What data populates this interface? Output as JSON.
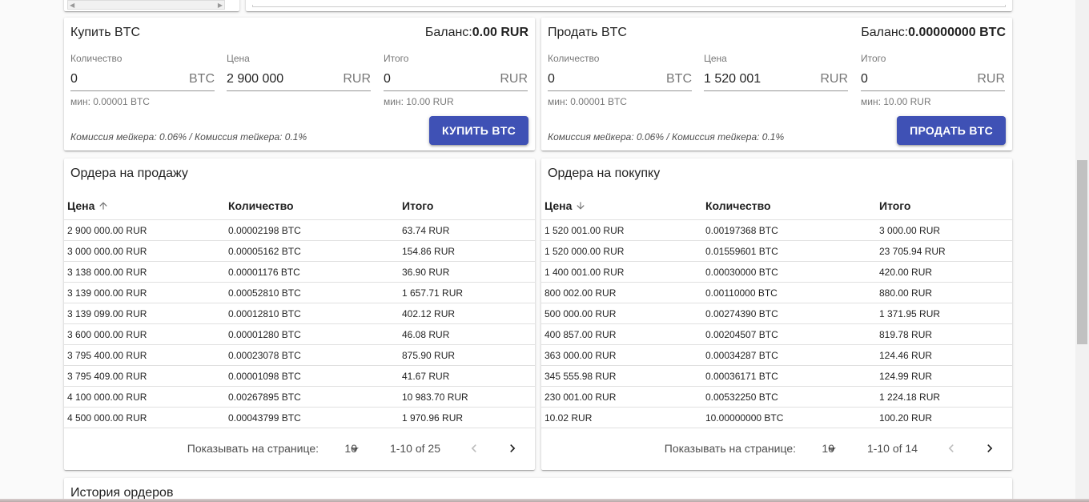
{
  "buy": {
    "title": "Купить BTC",
    "balance_label": "Баланс:",
    "balance_value": "0.00 RUR",
    "quantity": {
      "label": "Количество",
      "value": "0",
      "unit": "BTC",
      "hint": "мин: 0.00001 BTC"
    },
    "price": {
      "label": "Цена",
      "value": "2 900 000",
      "unit": "RUR"
    },
    "total": {
      "label": "Итого",
      "value": "0",
      "unit": "RUR",
      "hint": "мин: 10.00 RUR"
    },
    "commission": "Комиссия мейкера: 0.06% / Комиссия тейкера: 0.1%",
    "button": "КУПИТЬ BTC"
  },
  "sell": {
    "title": "Продать BTC",
    "balance_label": "Баланс:",
    "balance_value": "0.00000000 BTC",
    "quantity": {
      "label": "Количество",
      "value": "0",
      "unit": "BTC",
      "hint": "мин: 0.00001 BTC"
    },
    "price": {
      "label": "Цена",
      "value": "1 520 001",
      "unit": "RUR"
    },
    "total": {
      "label": "Итого",
      "value": "0",
      "unit": "RUR",
      "hint": "мин: 10.00 RUR"
    },
    "commission": "Комиссия мейкера: 0.06% / Комиссия тейкера: 0.1%",
    "button": "ПРОДАТЬ BTC"
  },
  "asks": {
    "title": "Ордера на продажу",
    "columns": [
      "Цена",
      "Количество",
      "Итого"
    ],
    "sort_icon": "arrow-up-icon",
    "rows": [
      [
        "2 900 000.00 RUR",
        "0.00002198 BTC",
        "63.74 RUR"
      ],
      [
        "3 000 000.00 RUR",
        "0.00005162 BTC",
        "154.86 RUR"
      ],
      [
        "3 138 000.00 RUR",
        "0.00001176 BTC",
        "36.90 RUR"
      ],
      [
        "3 139 000.00 RUR",
        "0.00052810 BTC",
        "1 657.71 RUR"
      ],
      [
        "3 139 099.00 RUR",
        "0.00012810 BTC",
        "402.12 RUR"
      ],
      [
        "3 600 000.00 RUR",
        "0.00001280 BTC",
        "46.08 RUR"
      ],
      [
        "3 795 400.00 RUR",
        "0.00023078 BTC",
        "875.90 RUR"
      ],
      [
        "3 795 409.00 RUR",
        "0.00001098 BTC",
        "41.67 RUR"
      ],
      [
        "4 100 000.00 RUR",
        "0.00267895 BTC",
        "10 983.70 RUR"
      ],
      [
        "4 500 000.00 RUR",
        "0.00043799 BTC",
        "1 970.96 RUR"
      ]
    ],
    "pager": {
      "label": "Показывать на странице:",
      "per_page": "10",
      "range": "1-10 of 25"
    }
  },
  "bids": {
    "title": "Ордера на покупку",
    "columns": [
      "Цена",
      "Количество",
      "Итого"
    ],
    "sort_icon": "arrow-down-icon",
    "rows": [
      [
        "1 520 001.00 RUR",
        "0.00197368 BTC",
        "3 000.00 RUR"
      ],
      [
        "1 520 000.00 RUR",
        "0.01559601 BTC",
        "23 705.94 RUR"
      ],
      [
        "1 400 001.00 RUR",
        "0.00030000 BTC",
        "420.00 RUR"
      ],
      [
        "800 002.00 RUR",
        "0.00110000 BTC",
        "880.00 RUR"
      ],
      [
        "500 000.00 RUR",
        "0.00274390 BTC",
        "1 371.95 RUR"
      ],
      [
        "400 857.00 RUR",
        "0.00204507 BTC",
        "819.78 RUR"
      ],
      [
        "363 000.00 RUR",
        "0.00034287 BTC",
        "124.46 RUR"
      ],
      [
        "345 555.98 RUR",
        "0.00036171 BTC",
        "124.99 RUR"
      ],
      [
        "230 001.00 RUR",
        "0.00532250 BTC",
        "1 224.18 RUR"
      ],
      [
        "10.02 RUR",
        "10.00000000 BTC",
        "100.20 RUR"
      ]
    ],
    "pager": {
      "label": "Показывать на странице:",
      "per_page": "10",
      "range": "1-10 of 14"
    }
  },
  "history": {
    "title": "История ордеров"
  },
  "colors": {
    "primary": "#3f51b5"
  }
}
